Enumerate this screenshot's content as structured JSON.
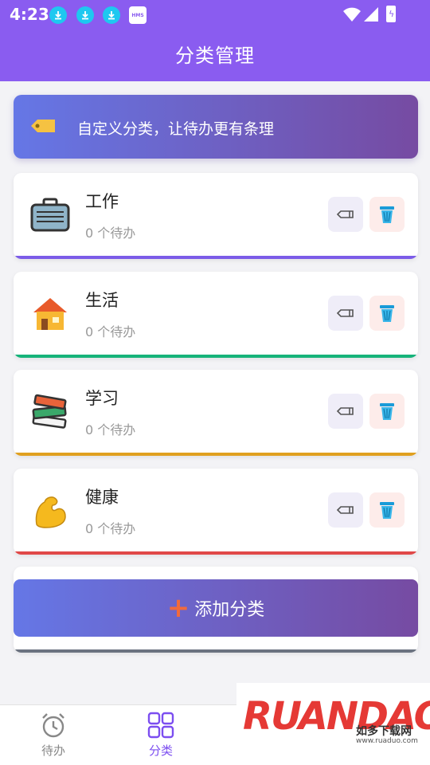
{
  "status_bar": {
    "time": "4:23",
    "hms_label": "HMS"
  },
  "header": {
    "title": "分类管理"
  },
  "banner": {
    "text": "自定义分类，让待办更有条理"
  },
  "categories": [
    {
      "name": "工作",
      "count": "0 个待办",
      "icon": "briefcase-icon",
      "accent": "#7c5ce8"
    },
    {
      "name": "生活",
      "count": "0 个待办",
      "icon": "house-icon",
      "accent": "#16b37a"
    },
    {
      "name": "学习",
      "count": "0 个待办",
      "icon": "books-icon",
      "accent": "#e0a020"
    },
    {
      "name": "健康",
      "count": "0 个待办",
      "icon": "flexed-bicep-icon",
      "accent": "#e04848"
    }
  ],
  "add_button": {
    "plus": "+",
    "label": "添加分类"
  },
  "bottom_nav": {
    "items": [
      {
        "label": "待办",
        "icon": "alarm-clock-icon",
        "active": false
      },
      {
        "label": "分类",
        "icon": "grid-icon",
        "active": true
      }
    ]
  },
  "watermark": {
    "logo": "RUANDAO",
    "subtitle": "如多下载网",
    "url": "www.ruaduo.com"
  },
  "colors": {
    "header": "#8a5cf0",
    "gradient_start": "#6577e6",
    "gradient_end": "#764ba2",
    "active_nav": "#7c4ef0"
  }
}
